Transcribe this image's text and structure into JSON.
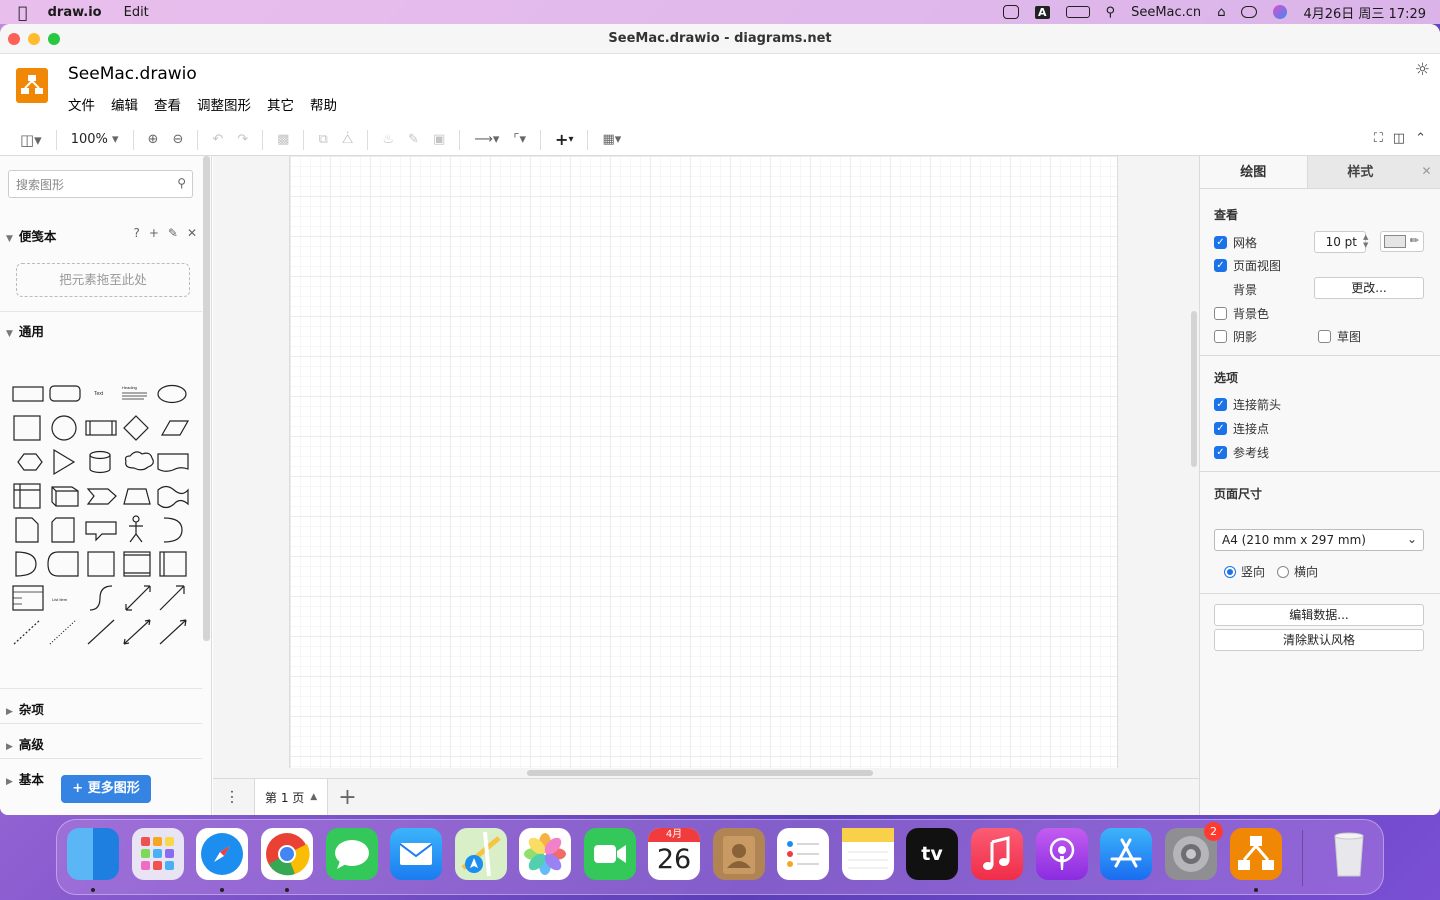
{
  "menubar": {
    "app": "draw.io",
    "edit": "Edit",
    "site": "SeeMac.cn",
    "datetime": "4月26日 周三 17:29"
  },
  "window": {
    "title": "SeeMac.drawio - diagrams.net"
  },
  "header": {
    "filename": "SeeMac.drawio",
    "menus": [
      "文件",
      "编辑",
      "查看",
      "调整图形",
      "其它",
      "帮助"
    ]
  },
  "toolbar": {
    "zoom": "100%"
  },
  "sidebar": {
    "search_placeholder": "搜索图形",
    "scratchpad": "便笺本",
    "scratchpad_help": "?",
    "dropzone": "把元素拖至此处",
    "general": "通用",
    "sections": [
      "杂项",
      "高级",
      "基本"
    ],
    "more_shapes": "+ 更多图形",
    "shape_text": "Text",
    "shape_heading": "Heading",
    "shape_listitem": "List Item"
  },
  "pages": {
    "current": "第 1 页"
  },
  "panel": {
    "tabs": [
      "绘图",
      "样式"
    ],
    "view_heading": "查看",
    "grid": "网格",
    "grid_size": "10 pt",
    "page_view": "页面视图",
    "background": "背景",
    "change": "更改...",
    "background_color": "背景色",
    "shadow": "阴影",
    "sketch": "草图",
    "options_heading": "选项",
    "connection_arrows": "连接箭头",
    "connection_points": "连接点",
    "guides": "参考线",
    "page_size_heading": "页面尺寸",
    "page_size": "A4 (210 mm x 297 mm)",
    "portrait": "竖向",
    "landscape": "横向",
    "edit_data": "编辑数据...",
    "clear_default_style": "清除默认风格"
  },
  "dock": {
    "calendar_month": "4月",
    "calendar_day": "26",
    "tv_label": "tv",
    "settings_badge": "2"
  },
  "colors": {
    "accent": "#1a73e8",
    "drawio_orange": "#f08705",
    "more_shapes_blue": "#3584e4"
  }
}
